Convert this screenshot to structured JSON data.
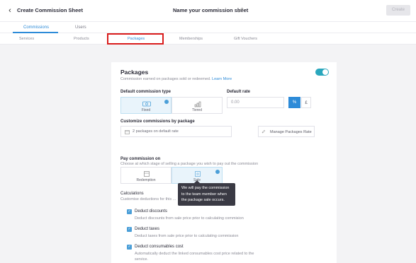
{
  "header": {
    "title": "Create Commission Sheet",
    "sheet_name": "Name your commission sheet",
    "create_label": "Create"
  },
  "tabs": [
    "Commissions",
    "Users"
  ],
  "subtabs": [
    "Services",
    "Products",
    "Packages",
    "Memberships",
    "Gift Vouchers"
  ],
  "section": {
    "title": "Packages",
    "description": "Commission earned on packages sold or redeemed.",
    "learn_more": "Learn More",
    "enabled": true
  },
  "commission_type": {
    "label": "Default commission type",
    "options": [
      "Fixed",
      "Tiered"
    ],
    "selected": "Fixed"
  },
  "default_rate": {
    "label": "Default rate",
    "placeholder": "0.00",
    "unit_percent": "%",
    "unit_currency": "£",
    "selected_unit": "%"
  },
  "customize": {
    "label": "Customize commissions by package",
    "summary": "2 packages on default rate",
    "manage_label": "Manage Packages Rate"
  },
  "pay_on": {
    "label": "Pay commission on",
    "description": "Choose at which stage of selling a package you wish to pay out the commission",
    "options": [
      "Redemption",
      "Sale"
    ],
    "selected": "Sale",
    "tooltip": "We will pay the commission to the team member when the package sale occurs."
  },
  "calculations": {
    "label": "Calculations",
    "description": "Customise deductions for this ...",
    "items": [
      {
        "title": "Deduct discounts",
        "description": "Deduct discounts from sale price prior to calculating commision",
        "checked": true
      },
      {
        "title": "Deduct taxes",
        "description": "Deduct taxes from sale price prior to calculating commission",
        "checked": true
      },
      {
        "title": "Deduct consumables cost",
        "description": "Automatically deduct the linked consumables cost price related to the service.",
        "checked": true
      }
    ]
  },
  "colors": {
    "accent": "#2d8bd8",
    "toggle": "#2aa7bd",
    "highlight": "#d91c1c"
  }
}
